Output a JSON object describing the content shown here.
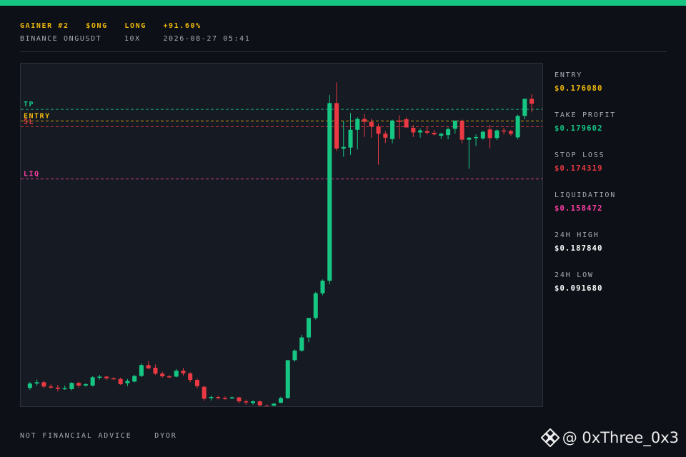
{
  "header": {
    "line1": [
      "GAINER #2",
      "$ONG",
      "LONG",
      "+91.60%"
    ],
    "line2": [
      "BINANCE ONGUSDT",
      "10X",
      "2026-08-27 05:41"
    ]
  },
  "levels": [
    {
      "key": "tp",
      "label": "TP",
      "price": 0.179602,
      "color": "#16c784"
    },
    {
      "key": "entry",
      "label": "ENTRY",
      "price": 0.17608,
      "color": "#f0b90b"
    },
    {
      "key": "sl",
      "label": "SL",
      "price": 0.174319,
      "color": "#ea3943"
    },
    {
      "key": "liq",
      "label": "LIQ",
      "price": 0.158472,
      "color": "#ff3fa4"
    }
  ],
  "stats": [
    {
      "label": "ENTRY",
      "value": "$0.176080",
      "color": "#f0b90b"
    },
    {
      "label": "TAKE PROFIT",
      "value": "$0.179602",
      "color": "#16c784"
    },
    {
      "label": "STOP LOSS",
      "value": "$0.174319",
      "color": "#ea3943"
    },
    {
      "label": "LIQUIDATION",
      "value": "$0.158472",
      "color": "#ff3fa4"
    },
    {
      "label": "24H HIGH",
      "value": "$0.187840",
      "color": "#ffffff"
    },
    {
      "label": "24H LOW",
      "value": "$0.091680",
      "color": "#ffffff"
    }
  ],
  "footer": [
    "NOT FINANCIAL ADVICE",
    "DYOR"
  ],
  "watermark": "@ 0xThree_0x3",
  "colors": {
    "up": "#16c784",
    "down": "#ea3943",
    "accent": "#16c784"
  },
  "chart_data": {
    "type": "candlestick",
    "ylim": [
      0.0895,
      0.1935
    ],
    "candles": [
      [
        0.0951,
        0.0969,
        0.0945,
        0.0964
      ],
      [
        0.0964,
        0.0976,
        0.0958,
        0.0968
      ],
      [
        0.0968,
        0.0972,
        0.095,
        0.0955
      ],
      [
        0.0955,
        0.0962,
        0.0948,
        0.0952
      ],
      [
        0.0952,
        0.096,
        0.094,
        0.0948
      ],
      [
        0.0948,
        0.0958,
        0.0945,
        0.095
      ],
      [
        0.0947,
        0.0968,
        0.0943,
        0.0966
      ],
      [
        0.0966,
        0.097,
        0.0952,
        0.0958
      ],
      [
        0.0958,
        0.0965,
        0.0955,
        0.0962
      ],
      [
        0.0958,
        0.0986,
        0.0955,
        0.0983
      ],
      [
        0.0983,
        0.099,
        0.0976,
        0.0985
      ],
      [
        0.0985,
        0.0988,
        0.0975,
        0.098
      ],
      [
        0.098,
        0.0983,
        0.0976,
        0.0978
      ],
      [
        0.0978,
        0.0982,
        0.096,
        0.0962
      ],
      [
        0.0965,
        0.0978,
        0.0956,
        0.0972
      ],
      [
        0.097,
        0.099,
        0.0968,
        0.0987
      ],
      [
        0.0987,
        0.1025,
        0.0984,
        0.102
      ],
      [
        0.102,
        0.1032,
        0.1008,
        0.101
      ],
      [
        0.1012,
        0.1022,
        0.099,
        0.0994
      ],
      [
        0.0994,
        0.1,
        0.0982,
        0.0986
      ],
      [
        0.0986,
        0.099,
        0.098,
        0.0984
      ],
      [
        0.0985,
        0.1008,
        0.0983,
        0.1003
      ],
      [
        0.1003,
        0.1012,
        0.0988,
        0.0995
      ],
      [
        0.0995,
        0.0998,
        0.0968,
        0.0975
      ],
      [
        0.0975,
        0.098,
        0.095,
        0.0956
      ],
      [
        0.0954,
        0.0958,
        0.0912,
        0.0918
      ],
      [
        0.092,
        0.0928,
        0.0912,
        0.0923
      ],
      [
        0.0923,
        0.0927,
        0.0916,
        0.092
      ],
      [
        0.092,
        0.0925,
        0.0915,
        0.0918
      ],
      [
        0.092,
        0.0925,
        0.0917,
        0.0922
      ],
      [
        0.0922,
        0.0924,
        0.0905,
        0.091
      ],
      [
        0.091,
        0.0915,
        0.09,
        0.0907
      ],
      [
        0.0905,
        0.0913,
        0.09,
        0.091
      ],
      [
        0.091,
        0.0912,
        0.0895,
        0.0898
      ],
      [
        0.0897,
        0.09,
        0.0893,
        0.0896
      ],
      [
        0.0897,
        0.0905,
        0.0893,
        0.0903
      ],
      [
        0.0906,
        0.0924,
        0.0904,
        0.092
      ],
      [
        0.092,
        0.0972,
        0.0918,
        0.1035
      ],
      [
        0.1035,
        0.1068,
        0.103,
        0.1064
      ],
      [
        0.1064,
        0.1112,
        0.106,
        0.1104
      ],
      [
        0.1104,
        0.1142,
        0.109,
        0.1163
      ],
      [
        0.1163,
        0.1242,
        0.1158,
        0.1238
      ],
      [
        0.1238,
        0.128,
        0.1232,
        0.1276
      ],
      [
        0.1276,
        0.184,
        0.1265,
        0.1815
      ],
      [
        0.1815,
        0.1878,
        0.167,
        0.1677
      ],
      [
        0.1677,
        0.176,
        0.1652,
        0.1682
      ],
      [
        0.168,
        0.1785,
        0.1658,
        0.1734
      ],
      [
        0.1734,
        0.1772,
        0.1674,
        0.1767
      ],
      [
        0.1767,
        0.1782,
        0.1712,
        0.1758
      ],
      [
        0.1758,
        0.1768,
        0.171,
        0.1744
      ],
      [
        0.1744,
        0.1752,
        0.1628,
        0.1722
      ],
      [
        0.1722,
        0.173,
        0.1694,
        0.171
      ],
      [
        0.1706,
        0.1765,
        0.1693,
        0.1762
      ],
      [
        0.1762,
        0.1778,
        0.1707,
        0.1758
      ],
      [
        0.1766,
        0.1772,
        0.1744,
        0.1741
      ],
      [
        0.174,
        0.1748,
        0.1712,
        0.1726
      ],
      [
        0.1726,
        0.1738,
        0.171,
        0.1732
      ],
      [
        0.173,
        0.1742,
        0.172,
        0.1725
      ],
      [
        0.1725,
        0.1733,
        0.1717,
        0.172
      ],
      [
        0.1716,
        0.1725,
        0.1706,
        0.1722
      ],
      [
        0.1718,
        0.1741,
        0.1705,
        0.1736
      ],
      [
        0.1737,
        0.1762,
        0.1722,
        0.1762
      ],
      [
        0.1761,
        0.1765,
        0.1693,
        0.1704
      ],
      [
        0.1704,
        0.1712,
        0.1616,
        0.171
      ],
      [
        0.1712,
        0.172,
        0.1685,
        0.1712
      ],
      [
        0.1708,
        0.1731,
        0.1704,
        0.1728
      ],
      [
        0.1735,
        0.1748,
        0.1678,
        0.1709
      ],
      [
        0.1709,
        0.1735,
        0.1703,
        0.1732
      ],
      [
        0.1732,
        0.174,
        0.172,
        0.173
      ],
      [
        0.173,
        0.1734,
        0.1716,
        0.1722
      ],
      [
        0.1711,
        0.178,
        0.1705,
        0.1776
      ],
      [
        0.1776,
        0.1818,
        0.1766,
        0.1828
      ],
      [
        0.1828,
        0.1842,
        0.1787,
        0.1813
      ]
    ]
  }
}
